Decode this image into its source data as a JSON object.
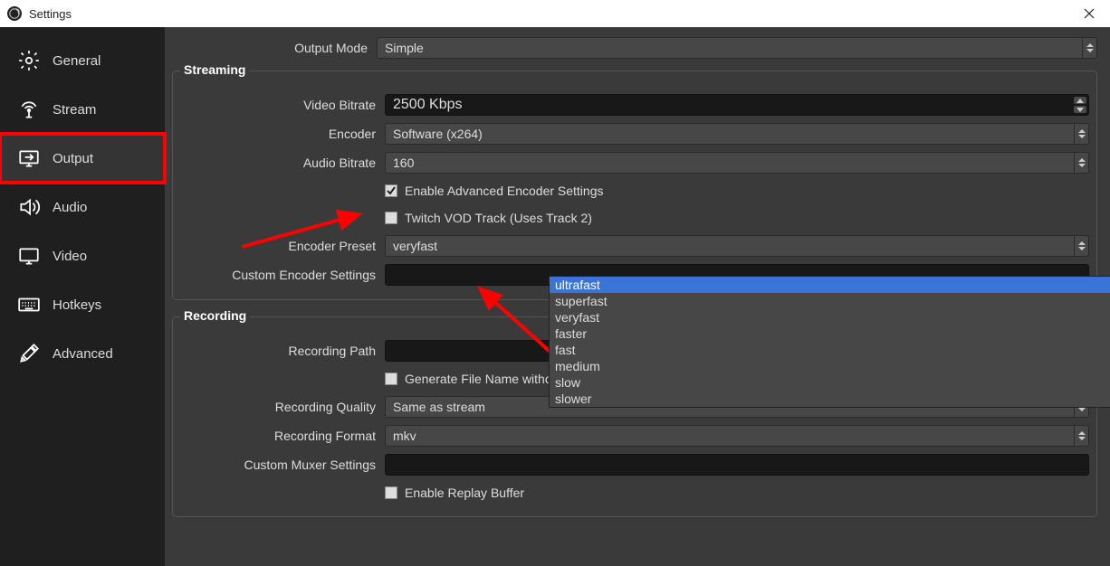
{
  "window": {
    "title": "Settings"
  },
  "sidebar": {
    "items": [
      {
        "label": "General"
      },
      {
        "label": "Stream"
      },
      {
        "label": "Output"
      },
      {
        "label": "Audio"
      },
      {
        "label": "Video"
      },
      {
        "label": "Hotkeys"
      },
      {
        "label": "Advanced"
      }
    ]
  },
  "output": {
    "mode_label": "Output Mode",
    "mode_value": "Simple"
  },
  "streaming": {
    "title": "Streaming",
    "video_bitrate_label": "Video Bitrate",
    "video_bitrate_value": "2500 Kbps",
    "encoder_label": "Encoder",
    "encoder_value": "Software (x264)",
    "audio_bitrate_label": "Audio Bitrate",
    "audio_bitrate_value": "160",
    "enable_adv_label": "Enable Advanced Encoder Settings",
    "twitch_vod_label": "Twitch VOD Track (Uses Track 2)",
    "preset_label": "Encoder Preset",
    "preset_value": "veryfast",
    "preset_options": [
      "ultrafast",
      "superfast",
      "veryfast",
      "faster",
      "fast",
      "medium",
      "slow",
      "slower"
    ],
    "custom_enc_label": "Custom Encoder Settings"
  },
  "recording": {
    "title": "Recording",
    "path_label": "Recording Path",
    "gen_filename_label": "Generate File Name without Space",
    "quality_label": "Recording Quality",
    "quality_value": "Same as stream",
    "format_label": "Recording Format",
    "format_value": "mkv",
    "muxer_label": "Custom Muxer Settings",
    "replay_buffer_label": "Enable Replay Buffer"
  }
}
